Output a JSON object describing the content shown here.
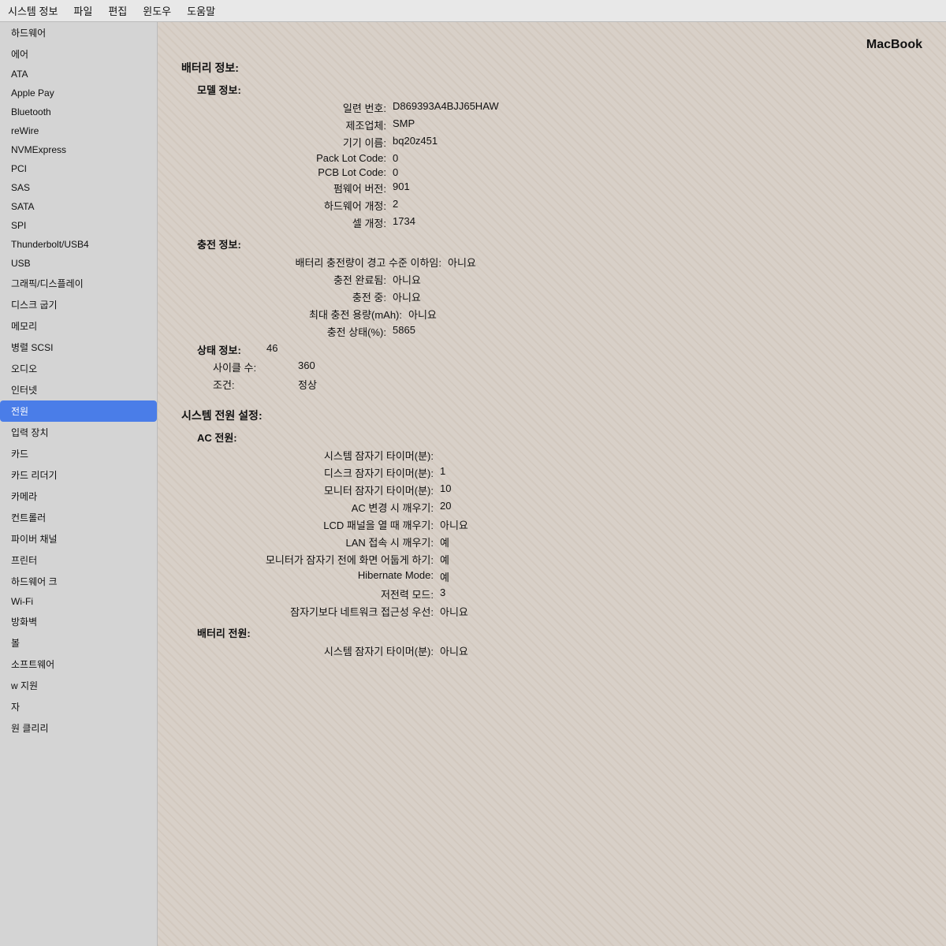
{
  "menubar": {
    "items": [
      "시스템 정보",
      "파일",
      "편집",
      "윈도우",
      "도움말"
    ]
  },
  "header": {
    "macbook_title": "MacBook"
  },
  "sidebar": {
    "items": [
      {
        "label": "하드웨어",
        "active": false
      },
      {
        "label": "에어",
        "active": false
      },
      {
        "label": "ATA",
        "active": false
      },
      {
        "label": "Apple Pay",
        "active": false
      },
      {
        "label": "Bluetooth",
        "active": false
      },
      {
        "label": "reWire",
        "active": false
      },
      {
        "label": "NVMExpress",
        "active": false
      },
      {
        "label": "PCI",
        "active": false
      },
      {
        "label": "SAS",
        "active": false
      },
      {
        "label": "SATA",
        "active": false
      },
      {
        "label": "SPI",
        "active": false
      },
      {
        "label": "Thunderbolt/USB4",
        "active": false
      },
      {
        "label": "USB",
        "active": false
      },
      {
        "label": "그래픽/디스플레이",
        "active": false
      },
      {
        "label": "디스크 굽기",
        "active": false
      },
      {
        "label": "메모리",
        "active": false
      },
      {
        "label": "병렬 SCSI",
        "active": false
      },
      {
        "label": "오디오",
        "active": false
      },
      {
        "label": "인터넷",
        "active": false
      },
      {
        "label": "전원",
        "active": true
      },
      {
        "label": "입력 장치",
        "active": false
      },
      {
        "label": "카드",
        "active": false
      },
      {
        "label": "카드 리더기",
        "active": false
      },
      {
        "label": "카메라",
        "active": false
      },
      {
        "label": "컨트롤러",
        "active": false
      },
      {
        "label": "파이버 채널",
        "active": false
      },
      {
        "label": "프린터",
        "active": false
      },
      {
        "label": "하드웨어 크",
        "active": false
      },
      {
        "label": "Wi-Fi",
        "active": false
      },
      {
        "label": "방화벽",
        "active": false
      },
      {
        "label": "볼",
        "active": false
      },
      {
        "label": "소프트웨어",
        "active": false
      },
      {
        "label": "w 지원",
        "active": false
      },
      {
        "label": "자",
        "active": false
      },
      {
        "label": "원 클리리",
        "active": false
      }
    ]
  },
  "battery": {
    "section_title": "배터리 정보:",
    "model_section": "모델 정보:",
    "serial_label": "일련 번호:",
    "serial_value": "D869393A4BJJ65HAW",
    "manufacturer_label": "제조업체:",
    "manufacturer_value": "SMP",
    "device_name_label": "기기 이름:",
    "device_name_value": "bq20z451",
    "pack_lot_label": "Pack Lot Code:",
    "pack_lot_value": "0",
    "pcb_lot_label": "PCB Lot Code:",
    "pcb_lot_value": "0",
    "firmware_label": "펌웨어 버전:",
    "firmware_value": "901",
    "hardware_rev_label": "하드웨어 개정:",
    "hardware_rev_value": "2",
    "cell_rev_label": "셀 개정:",
    "cell_rev_value": "1734",
    "charge_section": "충전 정보:",
    "low_charge_label": "배터리 충전량이 경고 수준 이하임:",
    "low_charge_value": "아니요",
    "charge_complete_label": "충전 완료됨:",
    "charge_complete_value": "아니요",
    "charging_label": "충전 중:",
    "charging_value": "아니요",
    "max_capacity_label": "최대 충전 용량(mAh):",
    "max_capacity_value": "아니요",
    "charge_state_label": "충전 상태(%):",
    "charge_state_value": "5865",
    "status_section": "상태 정보:",
    "status_value": "46",
    "cycle_label": "사이클 수:",
    "cycle_value": "360",
    "condition_label": "조건:",
    "condition_value": "정상"
  },
  "power_settings": {
    "section_title": "시스템 전원 설정:",
    "ac_section": "AC 전원:",
    "sys_sleep_label": "시스템 잠자기 타이머(분):",
    "sys_sleep_value": "",
    "disk_sleep_label": "디스크 잠자기 타이머(분):",
    "disk_sleep_value": "1",
    "monitor_sleep_label": "모니터 잠자기 타이머(분):",
    "monitor_sleep_value": "10",
    "ac_wake_label": "AC 변경 시 깨우기:",
    "ac_wake_value": "20",
    "lcd_wake_label": "LCD 패널을 열 때 깨우기:",
    "lcd_wake_value": "아니요",
    "lan_wake_label": "LAN 접속 시 깨우기:",
    "lan_wake_value": "예",
    "monitor_dim_label": "모니터가 잠자기 전에 화면 어둡게 하기:",
    "monitor_dim_value": "예",
    "hibernate_label": "Hibernate Mode:",
    "hibernate_value": "예",
    "low_power_label": "저전력 모드:",
    "low_power_value": "3",
    "network_access_label": "잠자기보다 네트워크 접근성 우선:",
    "network_access_value": "아니요",
    "battery_section": "배터리 전원:",
    "sys_sleep2_label": "시스템 잠자기 타이머(분):",
    "sys_sleep2_value": "아니요"
  }
}
